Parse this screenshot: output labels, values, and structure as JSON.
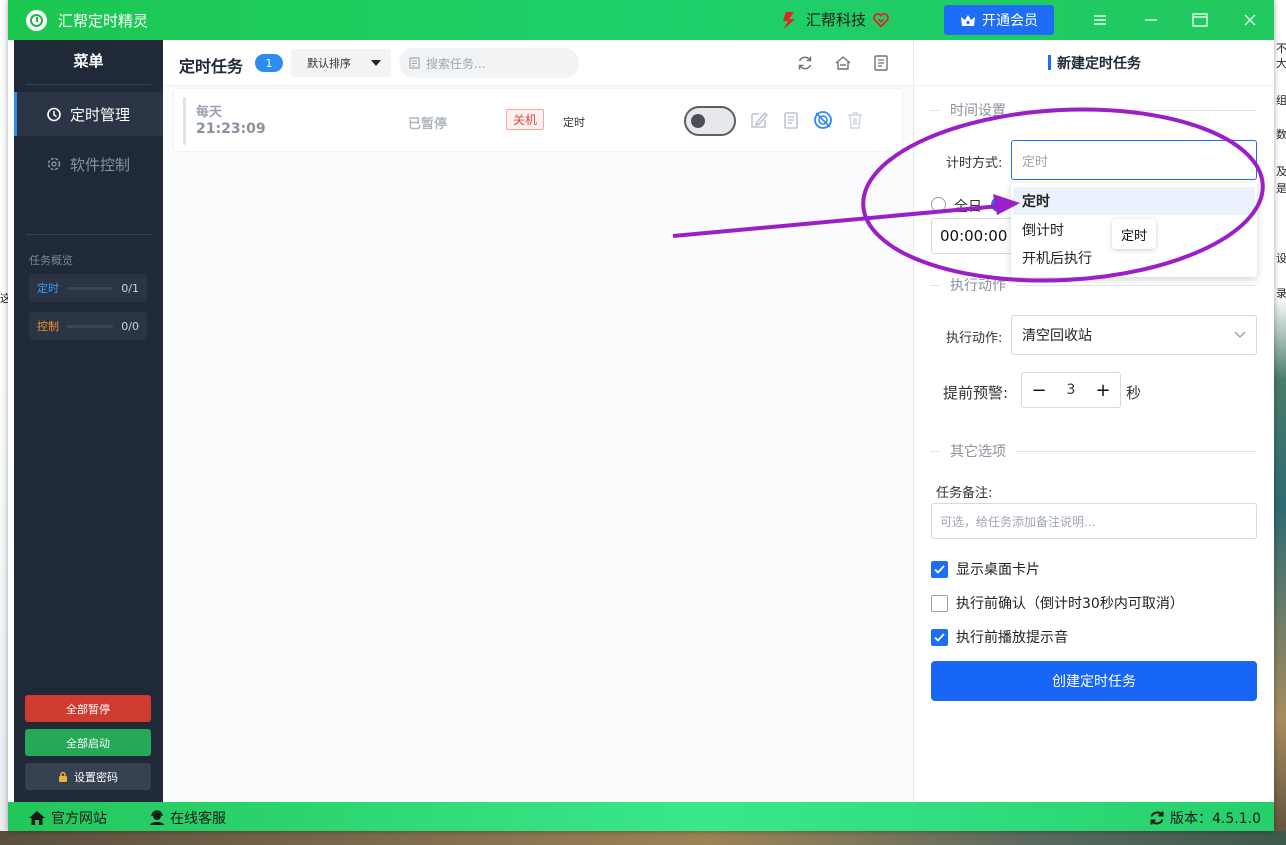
{
  "app": {
    "title": "汇帮定时精灵",
    "brand": "汇帮科技",
    "vip_label": "开通会员"
  },
  "colors": {
    "accent": "#1e6df6",
    "titlebar": "#1fd06a",
    "sidebar": "#1f2937",
    "pause": "#cf3b2f",
    "start": "#26a957",
    "annotation": "#9a1fc9"
  },
  "sidebar": {
    "title": "菜单",
    "nav": [
      {
        "label": "定时管理",
        "icon": "clock-icon",
        "active": true
      },
      {
        "label": "软件控制",
        "icon": "gear-icon",
        "active": false
      }
    ],
    "overview_title": "任务概览",
    "overview": [
      {
        "label": "定时",
        "count": "0/1",
        "color": "#3b9cf5"
      },
      {
        "label": "控制",
        "count": "0/0",
        "color": "#f0932b"
      }
    ],
    "pause_all": "全部暂停",
    "start_all": "全部启动",
    "set_password": "设置密码"
  },
  "main": {
    "title": "定时任务",
    "count": "1",
    "sort": "默认排序",
    "search_placeholder": "搜索任务...",
    "tasks": [
      {
        "frequency": "每天",
        "time": "21:23:09",
        "status": "已暂停",
        "tag": "关机",
        "type": "定时",
        "enabled": false
      }
    ]
  },
  "panel": {
    "title": "新建定时任务",
    "section_time": "时间设置",
    "timing_label": "计时方式:",
    "timing_placeholder": "定时",
    "timing_options": [
      "定时",
      "倒计时",
      "开机后执行"
    ],
    "selected_option": "定时",
    "tooltip": "定时",
    "radio_all_day": "全日",
    "time_value": "00:00:00",
    "section_action": "执行动作",
    "action_label": "执行动作:",
    "action_value": "清空回收站",
    "warn_label": "提前预警:",
    "warn_value": "3",
    "warn_unit": "秒",
    "section_other": "其它选项",
    "note_label": "任务备注:",
    "note_placeholder": "可选，给任务添加备注说明...",
    "options": [
      {
        "label": "显示桌面卡片",
        "checked": true
      },
      {
        "label": "执行前确认（倒计时30秒内可取消）",
        "checked": false
      },
      {
        "label": "执行前播放提示音",
        "checked": true
      }
    ],
    "create_label": "创建定时任务"
  },
  "status": {
    "website": "官方网站",
    "support": "在线客服",
    "version": "版本：4.5.1.0"
  },
  "desktop": {
    "right_chars": [
      "不",
      "大",
      "组",
      "数",
      "及",
      "是",
      "设",
      "录"
    ],
    "left_char": "这"
  }
}
